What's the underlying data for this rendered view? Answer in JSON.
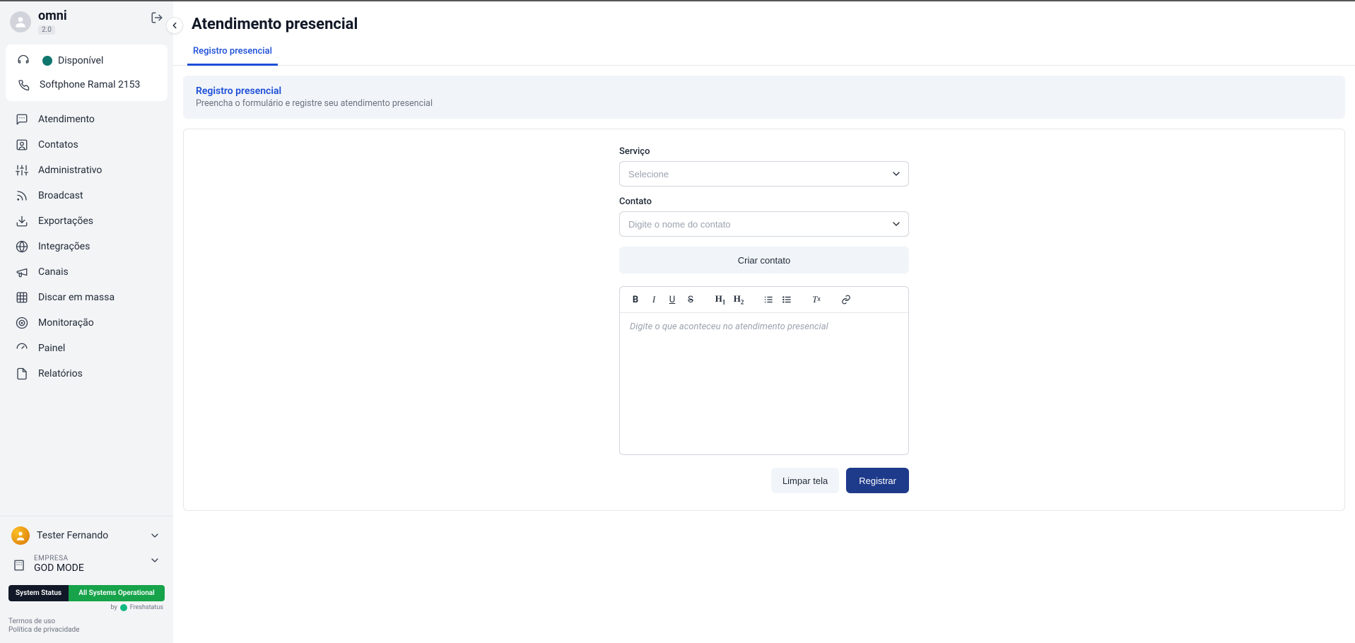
{
  "app": {
    "name": "omni",
    "version": "2.0"
  },
  "status": {
    "label": "Disponível"
  },
  "softphone": {
    "label": "Softphone Ramal 2153"
  },
  "nav": {
    "items": [
      {
        "label": "Atendimento"
      },
      {
        "label": "Contatos"
      },
      {
        "label": "Administrativo"
      },
      {
        "label": "Broadcast"
      },
      {
        "label": "Exportações"
      },
      {
        "label": "Integrações"
      },
      {
        "label": "Canais"
      },
      {
        "label": "Discar em massa"
      },
      {
        "label": "Monitoração"
      },
      {
        "label": "Painel"
      },
      {
        "label": "Relatórios"
      }
    ]
  },
  "user": {
    "name": "Tester Fernando"
  },
  "company": {
    "label": "EMPRESA",
    "name": "GOD MODE"
  },
  "systemStatus": {
    "left": "System Status",
    "right": "All Systems Operational",
    "by": "by",
    "provider": "Freshstatus"
  },
  "legal": {
    "terms": "Termos de uso",
    "privacy": "Política de privacidade"
  },
  "page": {
    "title": "Atendimento presencial",
    "tab": "Registro presencial",
    "banner": {
      "title": "Registro presencial",
      "subtitle": "Preencha o formulário e registre seu atendimento presencial"
    },
    "form": {
      "service_label": "Serviço",
      "service_placeholder": "Selecione",
      "contact_label": "Contato",
      "contact_placeholder": "Digite o nome do contato",
      "create_contact": "Criar contato",
      "editor_placeholder": "Digite o que aconteceu no atendimento presencial",
      "clear": "Limpar tela",
      "submit": "Registrar"
    }
  }
}
